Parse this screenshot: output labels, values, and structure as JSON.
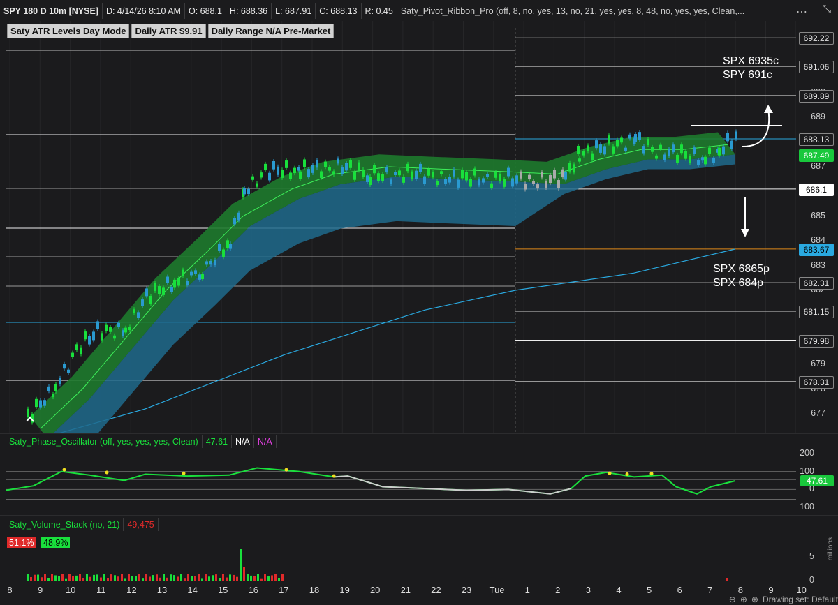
{
  "header": {
    "symbol": "SPY 180 D 10m [NYSE]",
    "date": "D: 4/14/26 8:10 AM",
    "open": "O: 688.1",
    "high": "H: 688.36",
    "low": "L: 687.91",
    "close": "C: 688.13",
    "range": "R: 0.45",
    "study": "Saty_Pivot_Ribbon_Pro (off, 8, no, yes, 13, no, 21, yes, yes, 8, 48, no, yes, yes, Clean,..."
  },
  "atr_badges": [
    "Saty ATR Levels Day Mode",
    "Daily ATR $9.91",
    "Daily Range N/A Pre-Market"
  ],
  "annotations": {
    "upper_line1": "SPX 6935c",
    "upper_line2": "SPY 691c",
    "lower_line1": "SPX 6865p",
    "lower_line2": "SPX 684p"
  },
  "price_axis": {
    "ticks": [
      "692",
      "691",
      "690",
      "689",
      "688",
      "687",
      "686",
      "685",
      "684",
      "683",
      "682",
      "681",
      "680",
      "679",
      "678",
      "677"
    ],
    "tags": [
      {
        "text": "692.22",
        "bg": "#1b1b1d",
        "fg": "#e0e0e0",
        "border": "#888888"
      },
      {
        "text": "691.06",
        "bg": "#1b1b1d",
        "fg": "#e0e0e0",
        "border": "#888888"
      },
      {
        "text": "689.89",
        "bg": "#1b1b1d",
        "fg": "#e0e0e0",
        "border": "#888888"
      },
      {
        "text": "688.13",
        "bg": "#1b1b1d",
        "fg": "#e0e0e0",
        "border": "#888888"
      },
      {
        "text": "687.49",
        "bg": "#19c83c",
        "fg": "#ffffff",
        "border": "#19c83c"
      },
      {
        "text": "686.1",
        "bg": "#ffffff",
        "fg": "#000000",
        "border": "#ffffff"
      },
      {
        "text": "683.67",
        "bg": "#2aa9e0",
        "fg": "#000000",
        "border": "#2aa9e0"
      },
      {
        "text": "682.31",
        "bg": "#1b1b1d",
        "fg": "#e0e0e0",
        "border": "#888888"
      },
      {
        "text": "681.15",
        "bg": "#1b1b1d",
        "fg": "#e0e0e0",
        "border": "#888888"
      },
      {
        "text": "679.98",
        "bg": "#1b1b1d",
        "fg": "#e0e0e0",
        "border": "#888888"
      },
      {
        "text": "678.31",
        "bg": "#1b1b1d",
        "fg": "#e0e0e0",
        "border": "#888888"
      }
    ]
  },
  "oscillator": {
    "name": "Saty_Phase_Oscillator (off, yes, yes, yes, Clean)",
    "value": "47.61",
    "na1": "N/A",
    "na2": "N/A",
    "axis": [
      "200",
      "100",
      "0",
      "-100"
    ],
    "tag": "47.61"
  },
  "volume": {
    "name": "Saty_Volume_Stack (no, 21)",
    "value": "49,475",
    "sell_pct": "51.1%",
    "buy_pct": "48.9%",
    "axis": [
      "5",
      "0"
    ],
    "side_label": "millions"
  },
  "time_axis": [
    "8",
    "9",
    "10",
    "11",
    "12",
    "13",
    "14",
    "15",
    "16",
    "17",
    "18",
    "19",
    "20",
    "21",
    "22",
    "23",
    "Tue",
    "1",
    "2",
    "3",
    "4",
    "5",
    "6",
    "7",
    "8",
    "9",
    "10"
  ],
  "drawing_status": "Drawing set: Default",
  "colors": {
    "up": "#19e03c",
    "down": "#e02a2a",
    "ribbon_fast": "#1e7a2e",
    "ribbon_slow": "#1f6a8c",
    "ema_line": "#2aa9e0",
    "atr_orange": "#e08a1a"
  }
}
